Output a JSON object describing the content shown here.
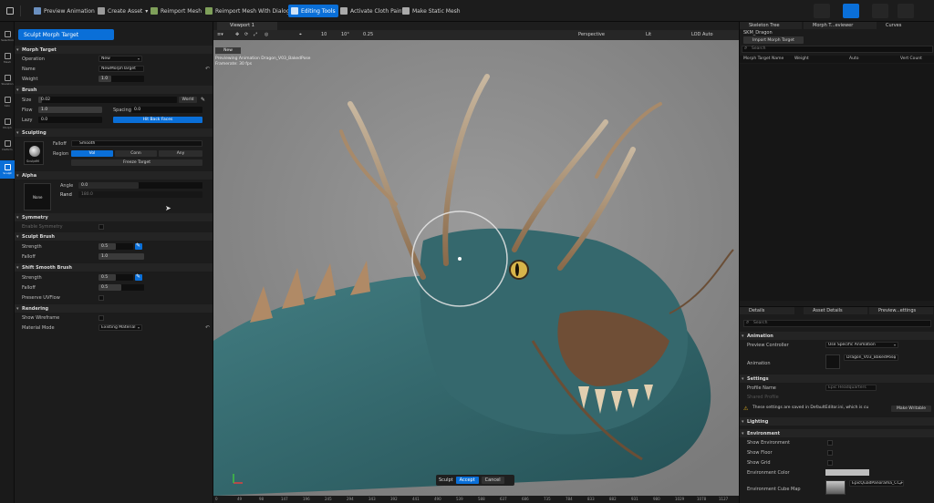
{
  "toolbar": {
    "items": [
      "Preview Animation",
      "Create Asset",
      "Reimport Mesh",
      "Reimport Mesh With Dialog",
      "Editing Tools",
      "Activate Cloth Paint",
      "Make Static Mesh"
    ]
  },
  "modestrip": {
    "items": [
      "Selection",
      "Mesh",
      "Skeleton",
      "Skin",
      "Morph",
      "Deform",
      "Sculpt"
    ]
  },
  "tool_panel": {
    "tab_label": "Sculpt Morph Target",
    "sections": {
      "morph_target": "Morph Target",
      "brush": "Brush",
      "sculpting": "Sculpting",
      "alpha": "Alpha",
      "symmetry": "Symmetry",
      "sculpt_brush": "Sculpt Brush",
      "shift_smooth": "Shift Smooth Brush",
      "rendering": "Rendering"
    },
    "operation_label": "Operation",
    "operation_value": "New",
    "name_label": "Name",
    "name_value": "NewMorphTarget",
    "weight_label": "Weight",
    "weight_value": "1.0",
    "size_label": "Size",
    "size_value": "0.02",
    "size_mode": "World",
    "flow_label": "Flow",
    "flow_value": "1.0",
    "spacing_label": "Spacing",
    "spacing_value": "0.0",
    "lazy_label": "Lazy",
    "lazy_value": "0.0",
    "hit_back_faces": "Hit Back Faces",
    "falloff_label": "Falloff",
    "falloff_value": "Smooth",
    "region_label": "Region",
    "region_options": [
      "Vol",
      "Conn",
      "Any"
    ],
    "freeze_target": "Freeze Target",
    "sculpt_thumb_label": "SculptM",
    "angle_label": "Angle",
    "angle_value": "0.0",
    "rand_label": "Rand",
    "rand_value": "180.0",
    "alpha_thumb_label": "None",
    "enable_symmetry": "Enable Symmetry",
    "strength_label": "Strength",
    "strength_value": "0.5",
    "falloff2_value": "1.0",
    "strength3_value": "0.5",
    "falloff3_value": "0.5",
    "preserve_uv": "Preserve UVFlow",
    "show_wireframe": "Show Wireframe",
    "material_mode_label": "Material Mode",
    "material_mode_value": "Existing Material"
  },
  "viewport": {
    "tab": "Viewport 1",
    "perspective": "Perspective",
    "lit": "Lit",
    "lod": "LOD Auto",
    "snap_values": [
      "10",
      "10°",
      "0.25"
    ],
    "info_line1": "Previewing Animation Dragon_V03_BakedPose",
    "info_line2": "Framerate: 30 fps",
    "badge": "New",
    "sculpt": "Sculpt",
    "accept": "Accept",
    "cancel": "Cancel",
    "timeline_ticks": [
      "0",
      "49",
      "98",
      "147",
      "196",
      "245",
      "294",
      "343",
      "392",
      "441",
      "490",
      "539",
      "588",
      "637",
      "686",
      "735",
      "784",
      "833",
      "882",
      "931",
      "980",
      "1029",
      "1078",
      "1127"
    ]
  },
  "right_panel": {
    "tabs": [
      "Skeleton Tree",
      "Morph T...eviewer",
      "Curves"
    ],
    "mesh_name": "SKM_Dragon",
    "import_morph": "Import Morph Target",
    "search_placeholder": "Search",
    "columns": [
      "Morph Target Name",
      "Weight",
      "Auto",
      "Vert Count"
    ],
    "tabs2": [
      "Details",
      "Asset Details",
      "Preview...ettings"
    ],
    "animation_section": "Animation",
    "preview_controller_label": "Preview Controller",
    "preview_controller_value": "Use Specific Animation",
    "animation_label": "Animation",
    "animation_value": "Dragon_V03_BakedPose",
    "settings_section": "Settings",
    "profile_name_label": "Profile Name",
    "profile_name_value": "Epic Headquarters",
    "shared_profile": "Shared Profile",
    "warning": "These settings are saved in DefaultEditor.ini, which is cu",
    "make_writable": "Make Writable",
    "lighting_section": "Lighting",
    "environment_section": "Environment",
    "show_environment": "Show Environment",
    "show_floor": "Show Floor",
    "show_grid": "Show Grid",
    "environment_color": "Environment Color",
    "environment_cube_map": "Environment Cube Map",
    "cube_map_value": "EpicQuadPanorama_CC+EV1"
  }
}
